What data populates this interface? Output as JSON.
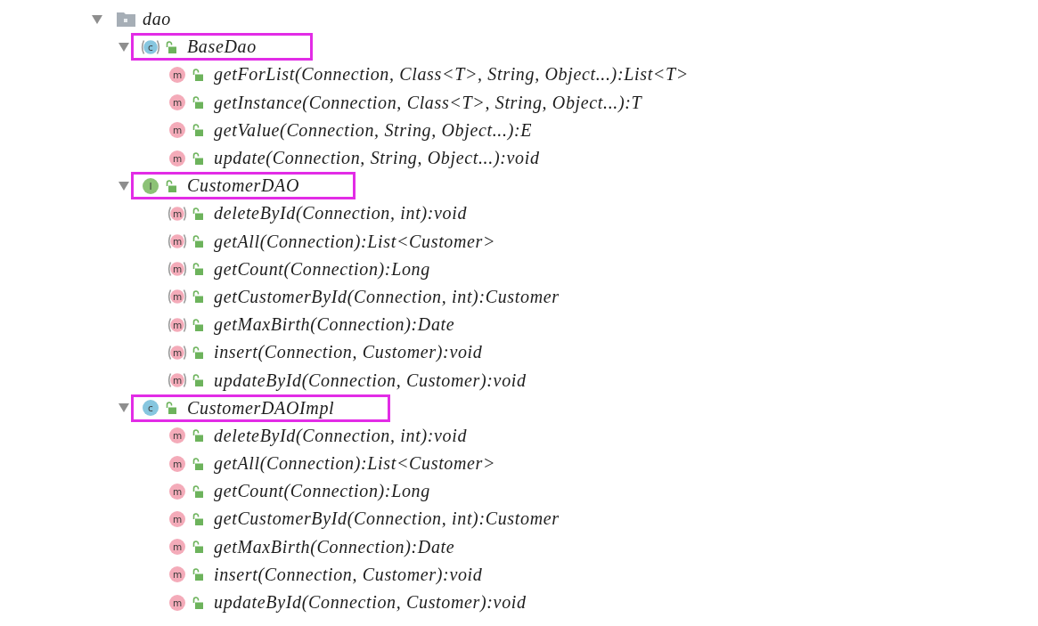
{
  "tree": {
    "label": "dao",
    "kind": "package",
    "expanded": true,
    "children": [
      {
        "label": "BaseDao",
        "kind": "class",
        "abstract": true,
        "icon_letter": "c",
        "expanded": true,
        "highlighted": true,
        "children": [
          {
            "label": "getForList(Connection, Class<T>, String, Object...):List<T>",
            "kind": "method",
            "abstract": false,
            "icon_letter": "m"
          },
          {
            "label": "getInstance(Connection, Class<T>, String, Object...):T",
            "kind": "method",
            "abstract": false,
            "icon_letter": "m"
          },
          {
            "label": "getValue(Connection, String, Object...):E",
            "kind": "method",
            "abstract": false,
            "icon_letter": "m"
          },
          {
            "label": "update(Connection, String, Object...):void",
            "kind": "method",
            "abstract": false,
            "icon_letter": "m"
          }
        ]
      },
      {
        "label": "CustomerDAO",
        "kind": "interface",
        "abstract": false,
        "icon_letter": "I",
        "expanded": true,
        "highlighted": true,
        "children": [
          {
            "label": "deleteById(Connection, int):void",
            "kind": "method",
            "abstract": true,
            "icon_letter": "m"
          },
          {
            "label": "getAll(Connection):List<Customer>",
            "kind": "method",
            "abstract": true,
            "icon_letter": "m"
          },
          {
            "label": "getCount(Connection):Long",
            "kind": "method",
            "abstract": true,
            "icon_letter": "m"
          },
          {
            "label": "getCustomerById(Connection, int):Customer",
            "kind": "method",
            "abstract": true,
            "icon_letter": "m"
          },
          {
            "label": "getMaxBirth(Connection):Date",
            "kind": "method",
            "abstract": true,
            "icon_letter": "m"
          },
          {
            "label": "insert(Connection, Customer):void",
            "kind": "method",
            "abstract": true,
            "icon_letter": "m"
          },
          {
            "label": "updateById(Connection, Customer):void",
            "kind": "method",
            "abstract": true,
            "icon_letter": "m"
          }
        ]
      },
      {
        "label": "CustomerDAOImpl",
        "kind": "class",
        "abstract": false,
        "icon_letter": "c",
        "expanded": true,
        "highlighted": true,
        "children": [
          {
            "label": "deleteById(Connection, int):void",
            "kind": "method",
            "abstract": false,
            "icon_letter": "m"
          },
          {
            "label": "getAll(Connection):List<Customer>",
            "kind": "method",
            "abstract": false,
            "icon_letter": "m"
          },
          {
            "label": "getCount(Connection):Long",
            "kind": "method",
            "abstract": false,
            "icon_letter": "m"
          },
          {
            "label": "getCustomerById(Connection, int):Customer",
            "kind": "method",
            "abstract": false,
            "icon_letter": "m"
          },
          {
            "label": "getMaxBirth(Connection):Date",
            "kind": "method",
            "abstract": false,
            "icon_letter": "m"
          },
          {
            "label": "insert(Connection, Customer):void",
            "kind": "method",
            "abstract": false,
            "icon_letter": "m"
          },
          {
            "label": "updateById(Connection, Customer):void",
            "kind": "method",
            "abstract": false,
            "icon_letter": "m"
          }
        ]
      }
    ]
  }
}
